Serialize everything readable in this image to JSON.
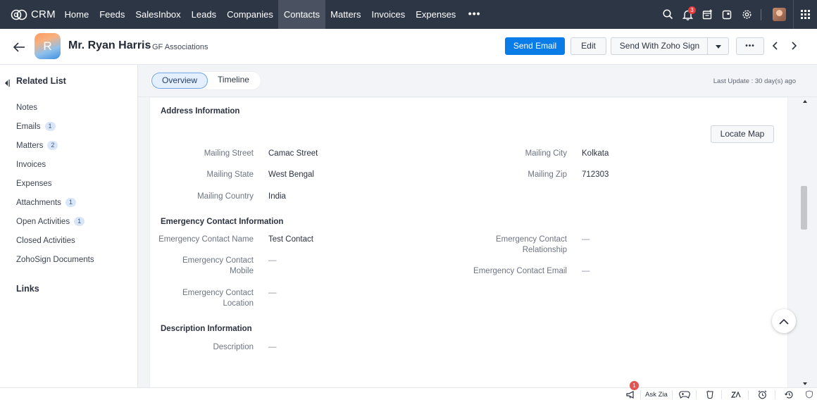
{
  "app": {
    "brand": "CRM"
  },
  "nav": {
    "items": [
      "Home",
      "Feeds",
      "SalesInbox",
      "Leads",
      "Companies",
      "Contacts",
      "Matters",
      "Invoices",
      "Expenses"
    ],
    "active": "Contacts",
    "more": "•••",
    "notification_count": "3"
  },
  "record": {
    "avatar_letter": "R",
    "name": "Mr. Ryan Harris",
    "separator": "-",
    "company": "GF Associations",
    "send_email": "Send Email",
    "edit": "Edit",
    "send_with_sign": "Send With Zoho Sign",
    "more": "•••"
  },
  "sidebar": {
    "title": "Related List",
    "items": [
      {
        "label": "Notes",
        "count": ""
      },
      {
        "label": "Emails",
        "count": "1"
      },
      {
        "label": "Matters",
        "count": "2"
      },
      {
        "label": "Invoices",
        "count": ""
      },
      {
        "label": "Expenses",
        "count": ""
      },
      {
        "label": "Attachments",
        "count": "1"
      },
      {
        "label": "Open Activities",
        "count": "1"
      },
      {
        "label": "Closed Activities",
        "count": ""
      },
      {
        "label": "ZohoSign Documents",
        "count": ""
      }
    ],
    "links_title": "Links"
  },
  "tabs": {
    "overview": "Overview",
    "timeline": "Timeline",
    "last_update": "Last Update : 30 day(s) ago"
  },
  "address": {
    "title": "Address Information",
    "locate_map": "Locate Map",
    "mailing_street_label": "Mailing Street",
    "mailing_street": "Camac Street",
    "mailing_city_label": "Mailing City",
    "mailing_city": "Kolkata",
    "mailing_state_label": "Mailing State",
    "mailing_state": "West Bengal",
    "mailing_zip_label": "Mailing Zip",
    "mailing_zip": "712303",
    "mailing_country_label": "Mailing Country",
    "mailing_country": "India"
  },
  "emergency": {
    "title": "Emergency Contact Information",
    "name_label": "Emergency Contact Name",
    "name": "Test Contact",
    "relationship_label_1": "Emergency Contact",
    "relationship_label_2": "Relationship",
    "relationship": "—",
    "mobile_label_1": "Emergency Contact",
    "mobile_label_2": "Mobile",
    "mobile": "—",
    "email_label": "Emergency Contact Email",
    "email": "—",
    "location_label_1": "Emergency Contact",
    "location_label_2": "Location",
    "location": "—"
  },
  "description": {
    "title": "Description Information",
    "label": "Description",
    "value": "—"
  },
  "bottombar": {
    "badge": "1",
    "ask_zia": "Ask Zia"
  }
}
